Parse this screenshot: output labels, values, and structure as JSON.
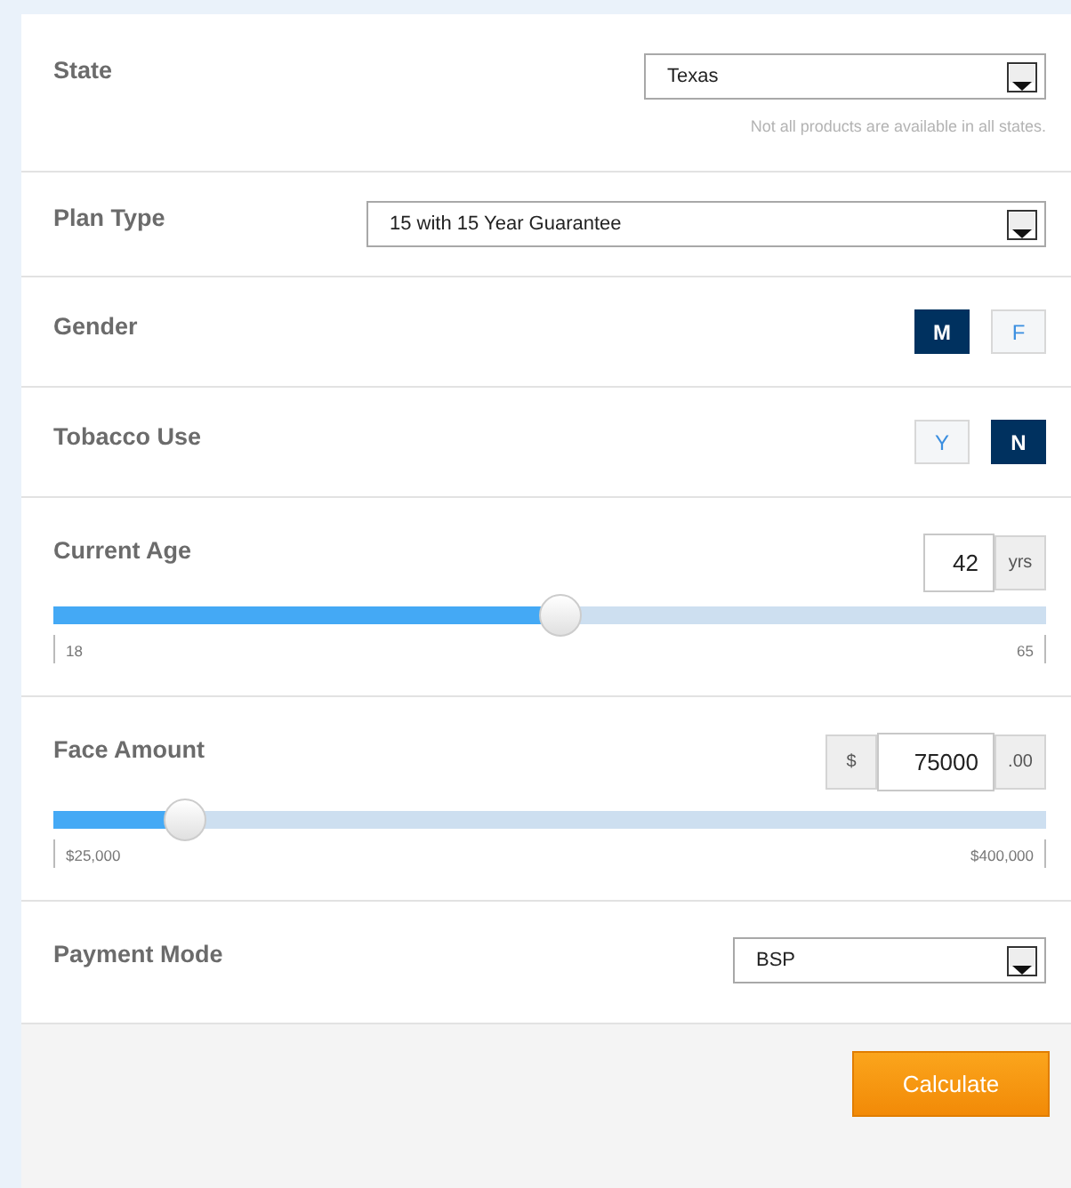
{
  "fields": [
    {
      "kind": "select",
      "label": "State",
      "value": "Texas",
      "note": "Not all products are available in all states."
    },
    {
      "kind": "select",
      "label": "Plan Type",
      "value": "15 with 15 Year Guarantee"
    },
    {
      "kind": "toggle",
      "label": "Gender",
      "options": [
        {
          "label": "M",
          "selected": true
        },
        {
          "label": "F",
          "selected": false
        }
      ]
    },
    {
      "kind": "toggle",
      "label": "Tobacco Use",
      "options": [
        {
          "label": "Y",
          "selected": false
        },
        {
          "label": "N",
          "selected": true
        }
      ]
    },
    {
      "kind": "slider",
      "label": "Current Age",
      "value": "42",
      "suffix": "yrs",
      "level": 0.51,
      "min_label": "18",
      "max_label": "65"
    },
    {
      "kind": "slider",
      "label": "Face Amount",
      "prefix": "$",
      "value": "75000",
      "suffix": ".00",
      "level": 0.133,
      "min_label": "$25,000",
      "max_label": "$400,000"
    },
    {
      "kind": "select",
      "label": "Payment Mode",
      "value": "BSP"
    }
  ],
  "action": {
    "label": "Calculate"
  }
}
